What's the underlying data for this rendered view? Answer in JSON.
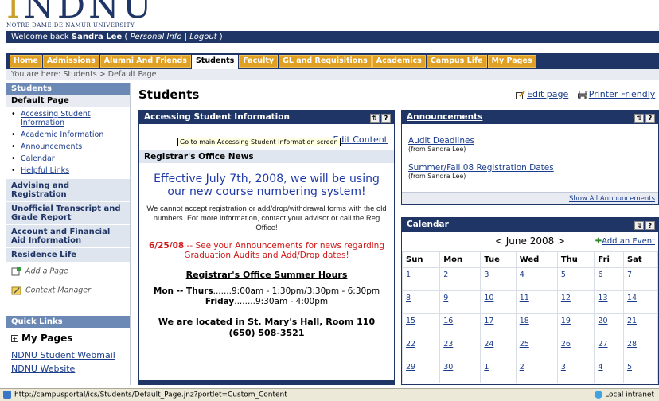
{
  "branding": {
    "logo_text": "NDNU",
    "logo_sub": "NOTRE DAME DE NAMUR UNIVERSITY"
  },
  "welcome": {
    "prefix": "Welcome back ",
    "user": "Sandra Lee",
    "open": " ( ",
    "personal": "Personal Info",
    "sep": " | ",
    "logout": "Logout",
    "close": " )"
  },
  "nav": {
    "tabs": [
      {
        "label": "Home"
      },
      {
        "label": "Admissions"
      },
      {
        "label": "Alumni And Friends"
      },
      {
        "label": "Students",
        "active": true
      },
      {
        "label": "Faculty"
      },
      {
        "label": "GL and Requisitions"
      },
      {
        "label": "Academics"
      },
      {
        "label": "Campus Life"
      },
      {
        "label": "My Pages"
      }
    ]
  },
  "breadcrumb": {
    "text": "You are here:  Students > Default Page"
  },
  "sidebar": {
    "header": "Students",
    "subheader": "Default Page",
    "items": [
      {
        "label": "Accessing Student Information"
      },
      {
        "label": "Academic Information"
      },
      {
        "label": "Announcements"
      },
      {
        "label": "Calendar"
      },
      {
        "label": "Helpful Links"
      }
    ],
    "sections": [
      {
        "label": "Advising and Registration"
      },
      {
        "label": "Unofficial Transcript and Grade Report"
      },
      {
        "label": "Account and Financial Aid Information"
      },
      {
        "label": "Residence Life"
      }
    ],
    "tools": {
      "add_page": "Add a Page",
      "context_manager": "Context Manager"
    },
    "quick_links": {
      "header": "Quick Links",
      "my_pages": "My Pages",
      "links": [
        "NDNU Student Webmail",
        "NDNU Website"
      ]
    }
  },
  "page": {
    "title": "Students",
    "edit_page": "Edit page",
    "printer_friendly": "Printer Friendly"
  },
  "accessing": {
    "title": "Accessing Student Information",
    "edit_content": "Edit Content",
    "tooltip": "Go to main Accessing Student Information screen",
    "news_header": "Registrar's Office News",
    "headline": "Effective July 7th, 2008, we will be using our new course numbering system!",
    "paragraph": "We cannot accept registration or add/drop/withdrawal forms with the old numbers.  For more information, contact your advisor or call the Reg Office!",
    "alert_date": "6/25/08",
    "alert_text": " -- See your Announcements for news regarding Graduation Audits and Add/Drop dates!",
    "summer_header": "Registrar's Office Summer Hours",
    "hours1_day": "Mon -- Thurs",
    "hours1_time": ".......9:00am - 1:30pm/3:30pm - 6:30pm",
    "hours2_day": "Friday",
    "hours2_time": "........9:30am - 4:00pm",
    "location": "We are located in St. Mary's Hall, Room 110 (650) 508-3521"
  },
  "announcements": {
    "title": "Announcements",
    "items": [
      {
        "label": "Audit Deadlines",
        "from": "(from Sandra Lee)"
      },
      {
        "label": "Summer/Fall 08 Registration Dates",
        "from": "(from Sandra Lee)"
      }
    ],
    "show_all": "Show All Announcements"
  },
  "calendar": {
    "title": "Calendar",
    "month": "< June 2008 >",
    "add_event": "Add an Event",
    "days": [
      "Sun",
      "Mon",
      "Tue",
      "Wed",
      "Thu",
      "Fri",
      "Sat"
    ],
    "weeks": [
      [
        "1",
        "2",
        "3",
        "4",
        "5",
        "6",
        "7"
      ],
      [
        "8",
        "9",
        "10",
        "11",
        "12",
        "13",
        "14"
      ],
      [
        "15",
        "16",
        "17",
        "18",
        "19",
        "20",
        "21"
      ],
      [
        "22",
        "23",
        "24",
        "25",
        "26",
        "27",
        "28"
      ],
      [
        "29",
        "30",
        "1",
        "2",
        "3",
        "4",
        "5"
      ]
    ]
  },
  "status": {
    "url": "http://campusportal/ics/Students/Default_Page.jnz?portlet=Custom_Content",
    "zone": "Local intranet"
  },
  "colors": {
    "navy": "#1f3566",
    "tab_gold": "#e0a024",
    "link": "#1a3c8c",
    "alert_red": "#d01818",
    "headline_blue": "#1f3aa8"
  }
}
